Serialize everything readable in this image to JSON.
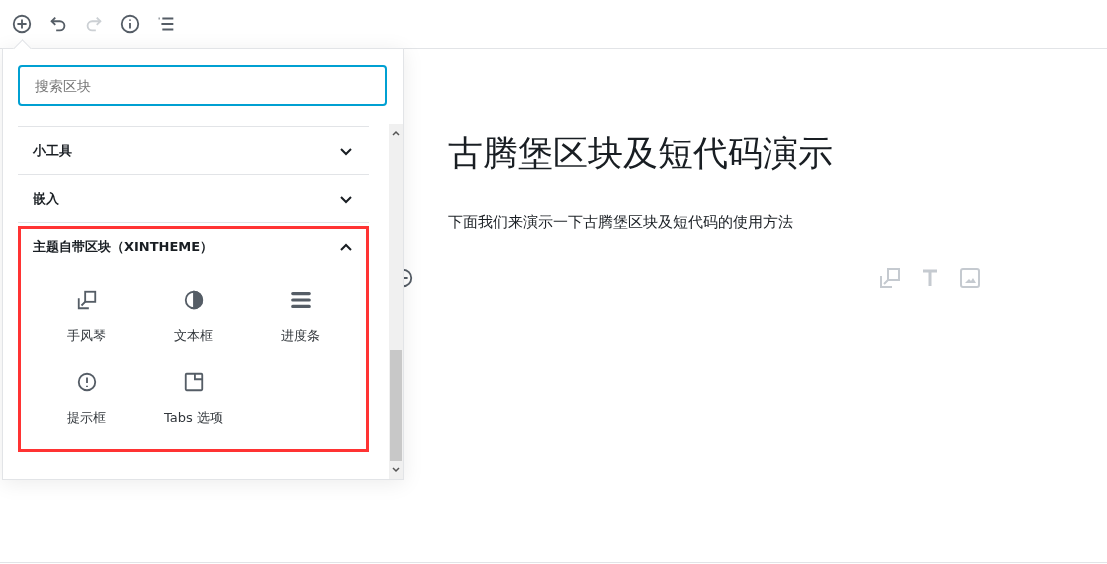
{
  "toolbar": [
    {
      "kind": "add",
      "disabled": false
    },
    {
      "kind": "undo",
      "disabled": false
    },
    {
      "kind": "redo",
      "disabled": true
    },
    {
      "kind": "info",
      "disabled": false
    },
    {
      "kind": "outline",
      "disabled": false
    }
  ],
  "inserter": {
    "search": {
      "placeholder": "搜索区块"
    },
    "categories": [
      {
        "label": "小工具",
        "expanded": false,
        "highlighted": false
      },
      {
        "label": "嵌入",
        "expanded": false,
        "highlighted": false
      },
      {
        "label": "主题自带区块（XINTHEME）",
        "expanded": true,
        "highlighted": true,
        "blocks": [
          {
            "kind": "accordion",
            "label": "手风琴"
          },
          {
            "kind": "contrast",
            "label": "文本框"
          },
          {
            "kind": "bars",
            "label": "进度条"
          },
          {
            "kind": "alert",
            "label": "提示框"
          },
          {
            "kind": "tabs",
            "label": "Tabs 选项"
          }
        ]
      }
    ]
  },
  "editor": {
    "title": "古腾堡区块及短代码演示",
    "paragraph": "下面我们来演示一下古腾堡区块及短代码的使用方法",
    "quick_blocks": [
      {
        "kind": "accordion"
      },
      {
        "kind": "heading"
      },
      {
        "kind": "image"
      }
    ]
  }
}
